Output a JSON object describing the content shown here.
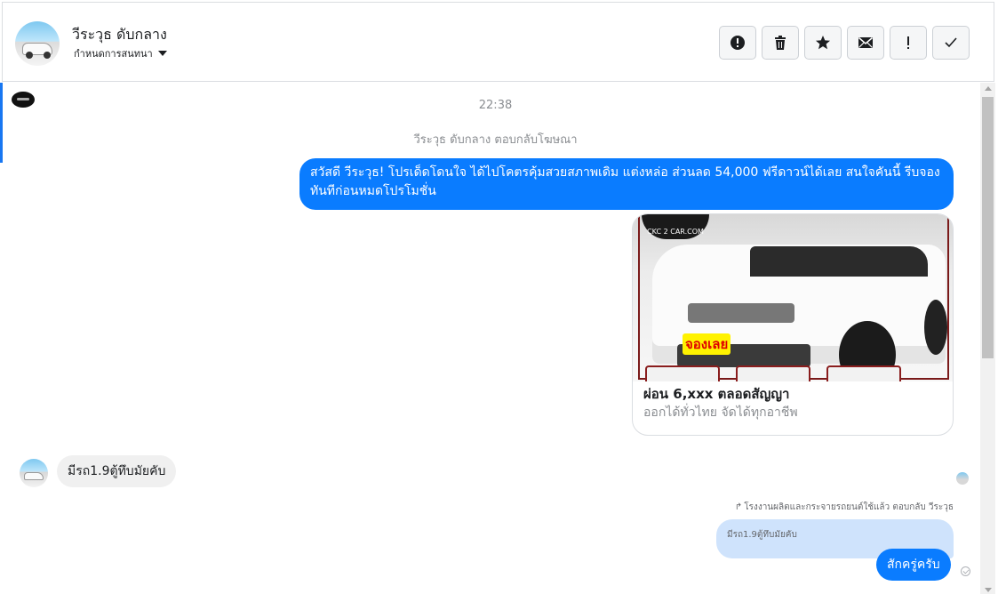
{
  "header": {
    "contact_name": "วีระวุธ ดับกลาง",
    "assign_label": "กำหนดการสนทนา",
    "tools": [
      {
        "name": "spam-icon",
        "glyph": "!"
      },
      {
        "name": "trash-icon",
        "glyph": "🗑"
      },
      {
        "name": "star-icon",
        "glyph": "★"
      },
      {
        "name": "mail-icon",
        "glyph": "✉"
      },
      {
        "name": "follow-up-icon",
        "glyph": "!"
      },
      {
        "name": "check-icon",
        "glyph": "✓"
      }
    ]
  },
  "thread": {
    "timestamp": "22:38",
    "ad_reply_note": "วีระวุธ ดับกลาง ตอบกลับโฆษณา",
    "outgoing_message": "สวัสดี วีระวุธ! โปรเด็ดโดนใจ ได้ไปโคตรคุ้มสวยสภาพเดิม แต่งหล่อ  ส่วนลด 54,000 ฟรีดาวน์ได้เลย  สนใจคันนี้ รีบจองทันทีก่อนหมดโปรโมชั่น",
    "ad_card": {
      "image_logo_text": "CKC 2 CAR.COM",
      "image_sticker_text": "จองเลย",
      "title": "ผ่อน 6,xxx ตลอดสัญญา",
      "subtitle": "ออกได้ทั่วไทย จัดได้ทุกอาชีพ"
    },
    "incoming_message": "มีรถ1.9ตู้ทึบมัยคับ",
    "page_reply_note": "โรงงานผลิตและกระจายรถยนต์ใช้แล้ว ตอบกลับ วีระวุธ",
    "quoted_message": "มีรถ1.9ตู้ทึบมัยคับ",
    "reply_message": "สักครู่ครับ"
  },
  "colors": {
    "accent": "#0a7cff",
    "incoming_bubble": "#f0f0f0",
    "quote_bubble": "#cfe3fc"
  }
}
